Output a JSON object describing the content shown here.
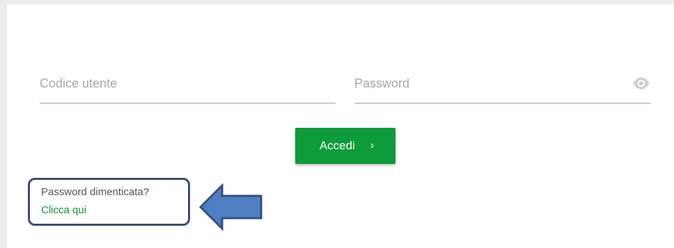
{
  "login": {
    "user_placeholder": "Codice utente",
    "password_placeholder": "Password",
    "show_password_icon": "eye-icon",
    "submit_label": "Accedi",
    "submit_icon": "chevron-right-icon",
    "submit_color": "#0e9b3b"
  },
  "forgot": {
    "question": "Password dimenticata?",
    "link_label": "Clicca qui",
    "link_color": "#13953a",
    "highlight_border_color": "#3a4f72",
    "arrow_color": "#4f7fc0"
  }
}
